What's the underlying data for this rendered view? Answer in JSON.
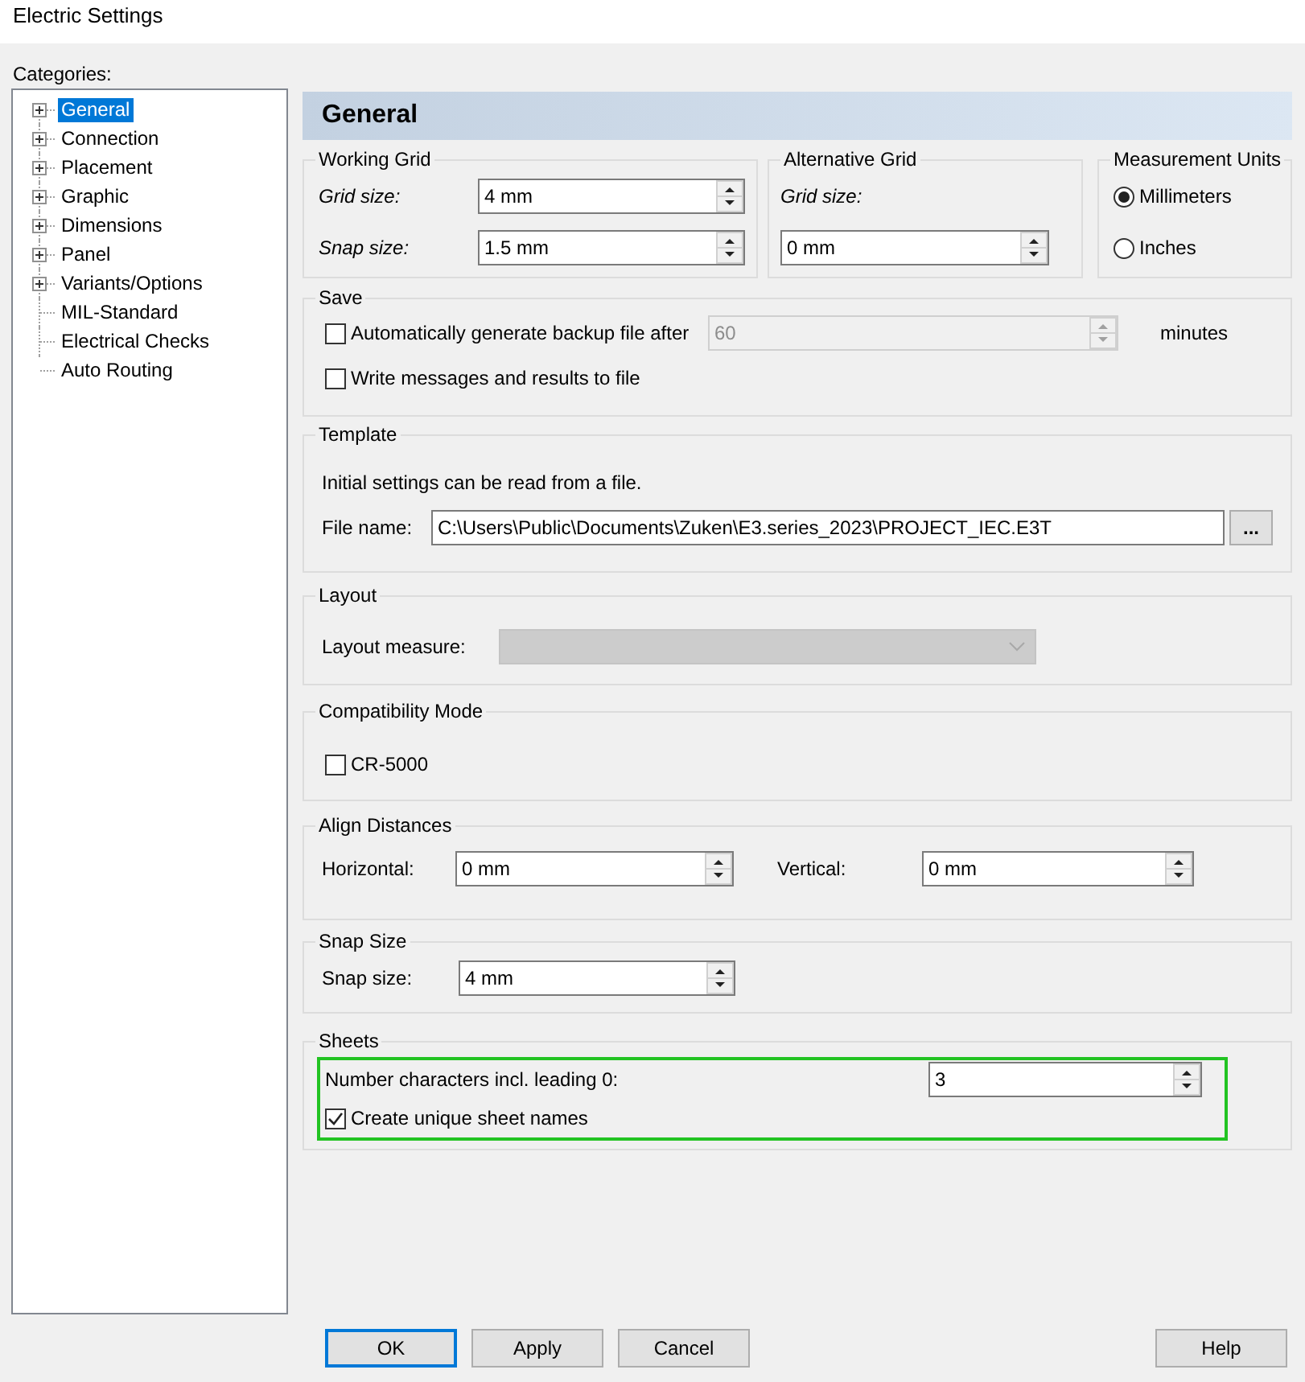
{
  "window": {
    "title": "Electric Settings"
  },
  "sidebar": {
    "label": "Categories:",
    "items": [
      {
        "label": "General",
        "expandable": true,
        "selected": true
      },
      {
        "label": "Connection",
        "expandable": true,
        "selected": false
      },
      {
        "label": "Placement",
        "expandable": true,
        "selected": false
      },
      {
        "label": "Graphic",
        "expandable": true,
        "selected": false
      },
      {
        "label": "Dimensions",
        "expandable": true,
        "selected": false
      },
      {
        "label": "Panel",
        "expandable": true,
        "selected": false
      },
      {
        "label": "Variants/Options",
        "expandable": true,
        "selected": false
      },
      {
        "label": "MIL-Standard",
        "expandable": false,
        "selected": false
      },
      {
        "label": "Electrical Checks",
        "expandable": false,
        "selected": false
      },
      {
        "label": "Auto Routing",
        "expandable": false,
        "selected": false
      }
    ]
  },
  "page": {
    "title": "General"
  },
  "top_row": [
    {
      "title": "Working Grid",
      "highlighted": false,
      "rows": [
        [
          {
            "kind": "label",
            "text": "Grid size:",
            "italic": true
          },
          {
            "kind": "spin",
            "value": "4 mm",
            "disabled": false
          }
        ],
        [
          {
            "kind": "label",
            "text": "Snap size:",
            "italic": true
          },
          {
            "kind": "spin",
            "value": "1.5 mm",
            "disabled": false
          }
        ]
      ]
    },
    {
      "title": "Alternative Grid",
      "highlighted": false,
      "rows": [
        [
          {
            "kind": "label",
            "text": "Grid size:",
            "italic": true
          }
        ],
        [
          {
            "kind": "spin",
            "value": "0 mm",
            "disabled": false
          }
        ]
      ]
    },
    {
      "title": "Measurement Units",
      "highlighted": false,
      "rows": [
        [
          {
            "kind": "radio",
            "text": "Millimeters",
            "selected": true
          }
        ],
        [
          {
            "kind": "radio",
            "text": "Inches",
            "selected": false
          }
        ]
      ]
    }
  ],
  "sections": [
    {
      "title": "Save",
      "highlighted": false,
      "rows": [
        [
          {
            "kind": "checkbox",
            "text": "Automatically generate backup file after",
            "checked": false
          },
          {
            "kind": "spin",
            "value": "60",
            "disabled": true
          },
          {
            "kind": "suffix",
            "text": "minutes"
          }
        ],
        [
          {
            "kind": "checkbox",
            "text": "Write messages and results to file",
            "checked": false
          }
        ]
      ]
    },
    {
      "title": "Template",
      "highlighted": false,
      "rows": [
        [
          {
            "kind": "note",
            "text": "Initial settings can be read from a file."
          }
        ],
        [
          {
            "kind": "label",
            "text": "File name:",
            "italic": false
          },
          {
            "kind": "text",
            "value": "C:\\Users\\Public\\Documents\\Zuken\\E3.series_2023\\PROJECT_IEC.E3T"
          },
          {
            "kind": "browse",
            "text": "..."
          }
        ]
      ]
    },
    {
      "title": "Layout",
      "highlighted": false,
      "rows": [
        [
          {
            "kind": "label",
            "text": "Layout measure:",
            "italic": false
          },
          {
            "kind": "combo",
            "disabled": true
          }
        ]
      ]
    },
    {
      "title": "Compatibility Mode",
      "highlighted": false,
      "rows": [
        [
          {
            "kind": "checkbox",
            "text": "CR-5000",
            "checked": false
          }
        ]
      ]
    },
    {
      "title": "Align Distances",
      "highlighted": false,
      "rows": [
        [
          {
            "kind": "label",
            "text": "Horizontal:",
            "italic": false
          },
          {
            "kind": "spin",
            "value": "0 mm",
            "disabled": false
          },
          {
            "kind": "label",
            "text": "Vertical:",
            "italic": false
          },
          {
            "kind": "spin",
            "value": "0 mm",
            "disabled": false
          }
        ]
      ]
    },
    {
      "title": "Snap Size",
      "highlighted": false,
      "rows": [
        [
          {
            "kind": "label",
            "text": "Snap size:",
            "italic": false
          },
          {
            "kind": "spin",
            "value": "4 mm",
            "disabled": false
          }
        ]
      ]
    },
    {
      "title": "Sheets",
      "highlighted": true,
      "rows": [
        [
          {
            "kind": "label",
            "text": "Number characters incl. leading 0:",
            "italic": false
          },
          {
            "kind": "spin",
            "value": "3",
            "disabled": false
          }
        ],
        [
          {
            "kind": "checkbox",
            "text": "Create unique sheet names",
            "checked": true
          }
        ]
      ]
    }
  ],
  "buttons": [
    {
      "label": "OK",
      "default": true
    },
    {
      "label": "Apply",
      "default": false
    },
    {
      "label": "Cancel",
      "default": false
    }
  ],
  "help_button": {
    "label": "Help"
  }
}
